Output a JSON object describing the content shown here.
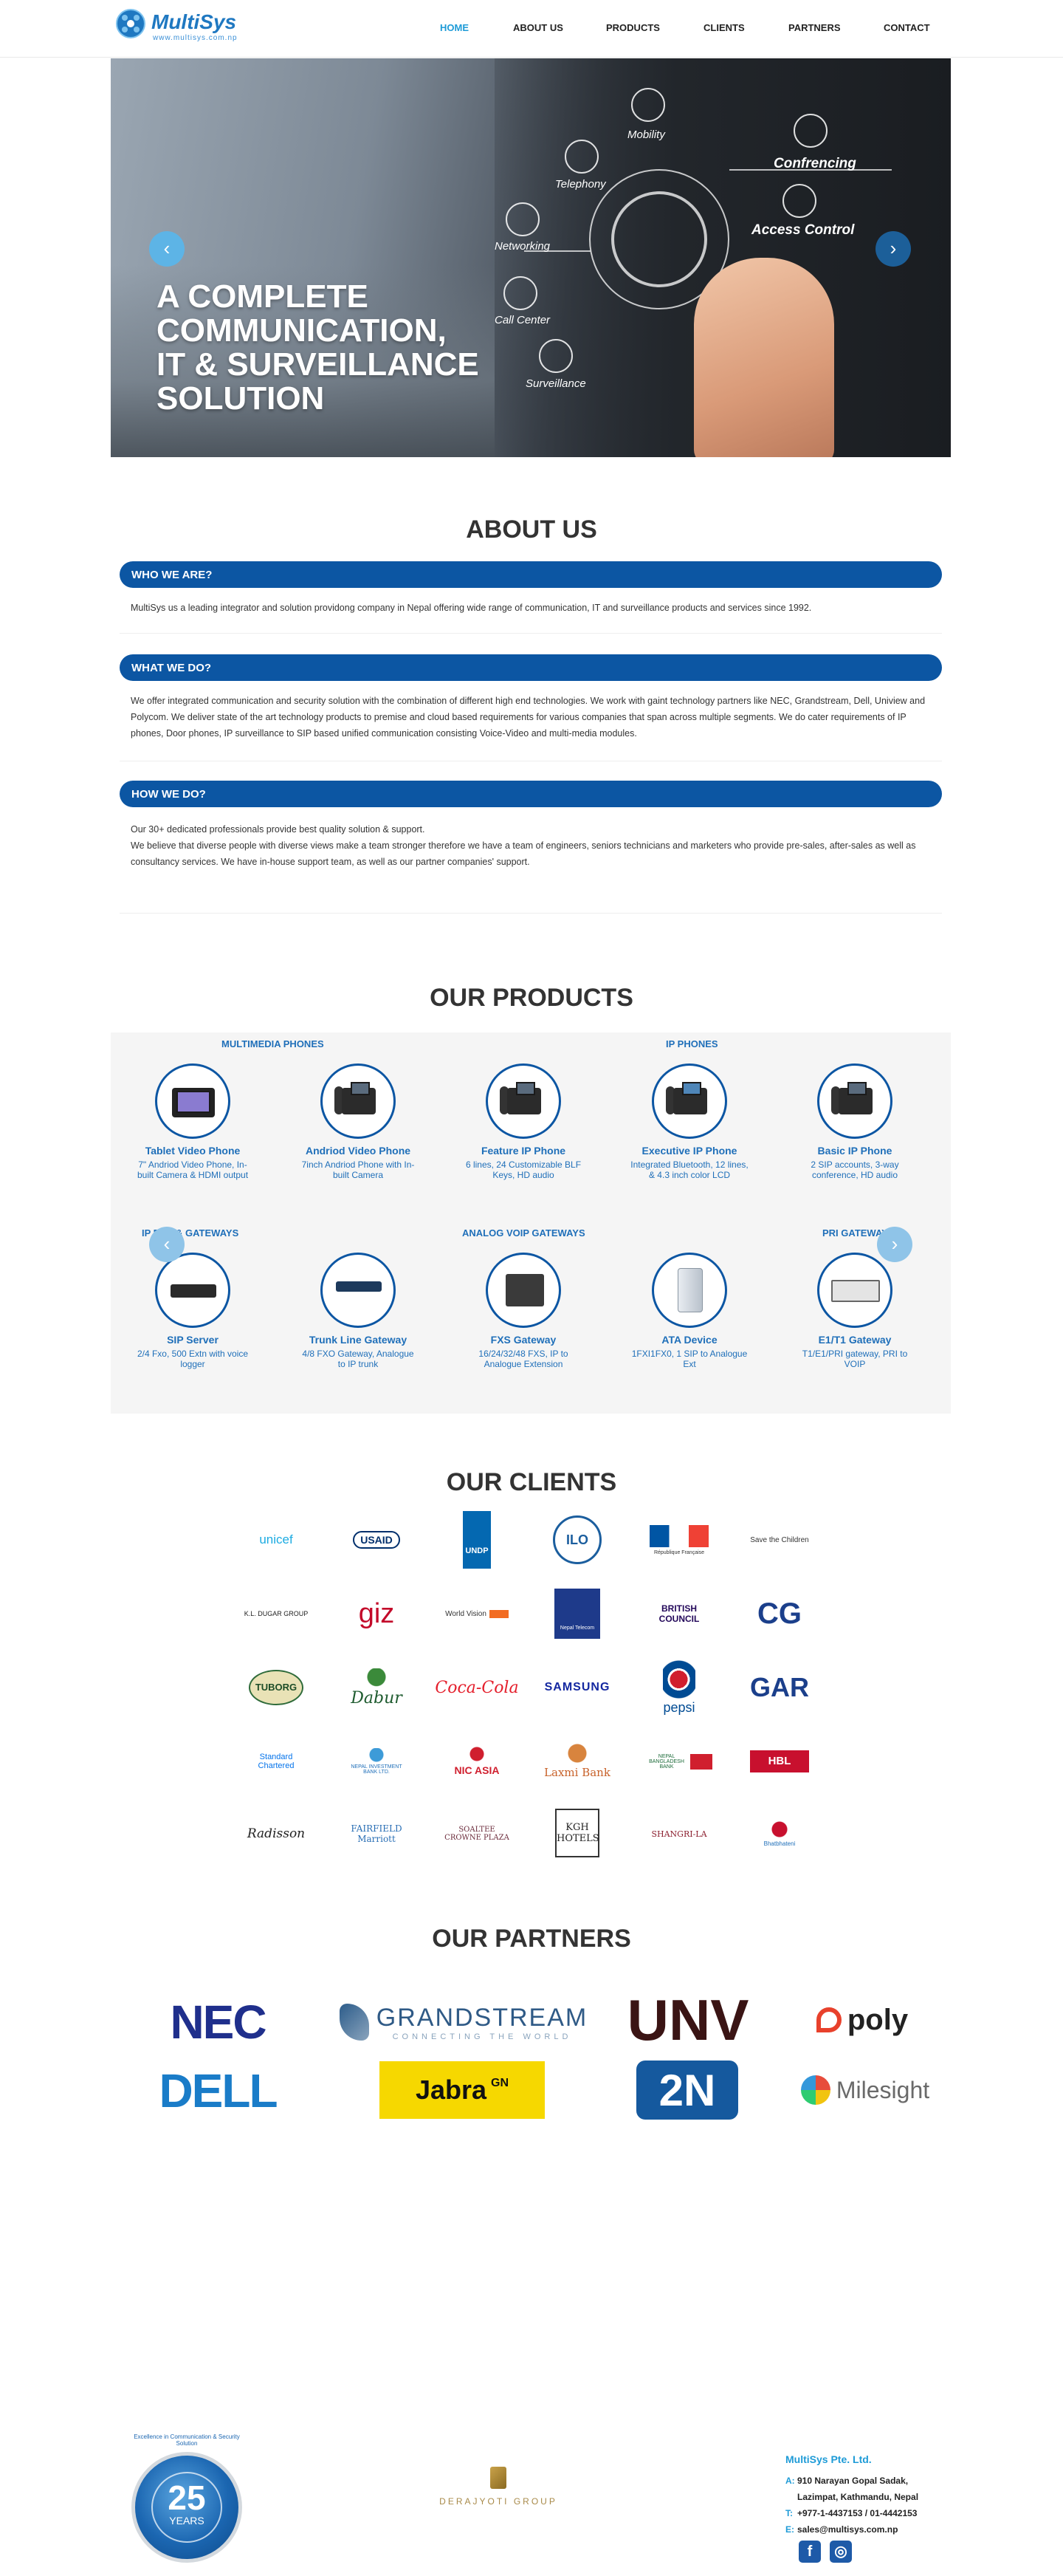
{
  "header": {
    "logo_title": "MultiSys",
    "logo_sub": "www.multisys.com.np",
    "nav": [
      "HOME",
      "ABOUT US",
      "PRODUCTS",
      "CLIENTS",
      "PARTNERS",
      "CONTACT"
    ]
  },
  "hero": {
    "headline": [
      "A COMPLETE",
      "COMMUNICATION,",
      "IT & SURVEILLANCE",
      "SOLUTION"
    ],
    "labels": [
      "Mobility",
      "Telephony",
      "Confrencing",
      "Access Control",
      "Networking",
      "Call Center",
      "Surveillance"
    ],
    "prev": "‹",
    "next": "›"
  },
  "about": {
    "title": "ABOUT US",
    "who_heading": "WHO WE ARE?",
    "who_text": "MultiSys us a leading integrator and solution providong company in Nepal offering wide range of communication, IT and surveillance products and services since 1992.",
    "what_heading": "WHAT WE DO?",
    "what_text": "We offer integrated communication and security solution with the combination of different high end technologies. We work with gaint technology partners like NEC, Grandstream, Dell, Uniview and Polycom. We deliver state of the art technology products to premise and cloud based requirements for various companies that span across multiple segments. We do cater requirements of IP phones, Door phones, IP surveillance to SIP based unified communication consisting Voice-Video and multi-media modules.",
    "how_heading": "HOW WE DO?",
    "how_text_1": "Our 30+ dedicated professionals provide best quality solution & support.",
    "how_text_2": "We believe that diverse people with diverse views make a team stronger therefore we have a team of engineers, seniors technicians and marketers who provide pre-sales, after-sales as well as consultancy services. We have in-house support team, as well as our partner companies' support."
  },
  "products": {
    "title": "OUR PRODUCTS",
    "categories_row1": [
      "MULTIMEDIA PHONES",
      "IP PHONES"
    ],
    "categories_row2": [
      "IP PBX & GATEWAYS",
      "ANALOG VOIP GATEWAYS",
      "PRI GATEWAYS"
    ],
    "row1": [
      {
        "name": "Tablet Video Phone",
        "desc": "7\" Andriod Video Phone, In-built Camera & HDMI output",
        "icon": "tablet-phone-icon"
      },
      {
        "name": "Andriod Video Phone",
        "desc": "7inch Andriod Phone with In-built Camera",
        "icon": "android-phone-icon"
      },
      {
        "name": "Feature IP Phone",
        "desc": "6 lines, 24 Customizable BLF Keys, HD audio",
        "icon": "feature-phone-icon"
      },
      {
        "name": "Executive IP Phone",
        "desc": "Integrated Bluetooth, 12 lines, & 4.3 inch color LCD",
        "icon": "executive-phone-icon"
      },
      {
        "name": "Basic IP Phone",
        "desc": "2 SIP accounts, 3-way conference, HD audio",
        "icon": "basic-phone-icon"
      }
    ],
    "row2": [
      {
        "name": "SIP Server",
        "desc": "2/4 Fxo, 500 Extn with voice logger",
        "icon": "sip-server-icon"
      },
      {
        "name": "Trunk Line Gateway",
        "desc": "4/8 FXO Gateway, Analogue to IP trunk",
        "icon": "trunk-gateway-icon"
      },
      {
        "name": "FXS Gateway",
        "desc": "16/24/32/48 FXS, IP to Analogue Extension",
        "icon": "fxs-gateway-icon"
      },
      {
        "name": "ATA Device",
        "desc": "1FXI1FX0, 1 SIP to Analogue Ext",
        "icon": "ata-device-icon"
      },
      {
        "name": "E1/T1 Gateway",
        "desc": "T1/E1/PRI gateway, PRI to VOIP",
        "icon": "e1-t1-gateway-icon"
      }
    ],
    "prev": "‹",
    "next": "›"
  },
  "clients": {
    "title": "OUR CLIENTS",
    "rows": [
      [
        "unicef",
        "USAID",
        "UNDP",
        "ILO",
        "République Française",
        "Save the Children"
      ],
      [
        "K.L. DUGAR GROUP",
        "giz",
        "World Vision",
        "Nepal Telecom",
        "BRITISH COUNCIL",
        "CG"
      ],
      [
        "TUBORG",
        "Dabur",
        "Coca-Cola",
        "SAMSUNG",
        "pepsi",
        "GAR"
      ],
      [
        "Standard Chartered",
        "NEPAL INVESTMENT BANK LTD.",
        "NIC ASIA",
        "Laxmi Bank",
        "NEPAL BANGLADESH BANK",
        "HBL"
      ],
      [
        "Radisson",
        "FAIRFIELD Marriott",
        "SOALTEE CROWNE PLAZA",
        "KGH HOTELS",
        "SHANGRI-LA",
        "Bhatbhateni"
      ]
    ],
    "colors": {
      "unicef": "#1cabe2",
      "usaid": "#002f6c",
      "undp": "#0468b1",
      "giz": "#c30a2a",
      "coca": "#e41e2b",
      "pepsi": "#004b93",
      "nic": "#d01f2e",
      "laxmi": "#c8622a",
      "hbl": "#c8102e"
    }
  },
  "partners": {
    "title": "OUR PARTNERS",
    "items": [
      "NEC",
      "GRANDSTREAM",
      "CONNECTING THE WORLD",
      "UNV",
      "poly",
      "DELL",
      "Jabra",
      "GN",
      "2N",
      "Milesight"
    ]
  },
  "footer": {
    "badge_num": "25",
    "badge_years": "YEARS",
    "badge_ring": "Excellence in Communication & Security Solution",
    "group_name": "DERAJYOTI GROUP",
    "company": "MultiSys Pte. Ltd.",
    "address_key": "A:",
    "address_1": "910 Narayan Gopal Sadak,",
    "address_2": "Lazimpat, Kathmandu, Nepal",
    "phone_key": "T:",
    "phone": "+977-1-4437153 / 01-4442153",
    "email_key": "E:",
    "email": "sales@multisys.com.np",
    "social": [
      "f",
      "◎"
    ]
  }
}
